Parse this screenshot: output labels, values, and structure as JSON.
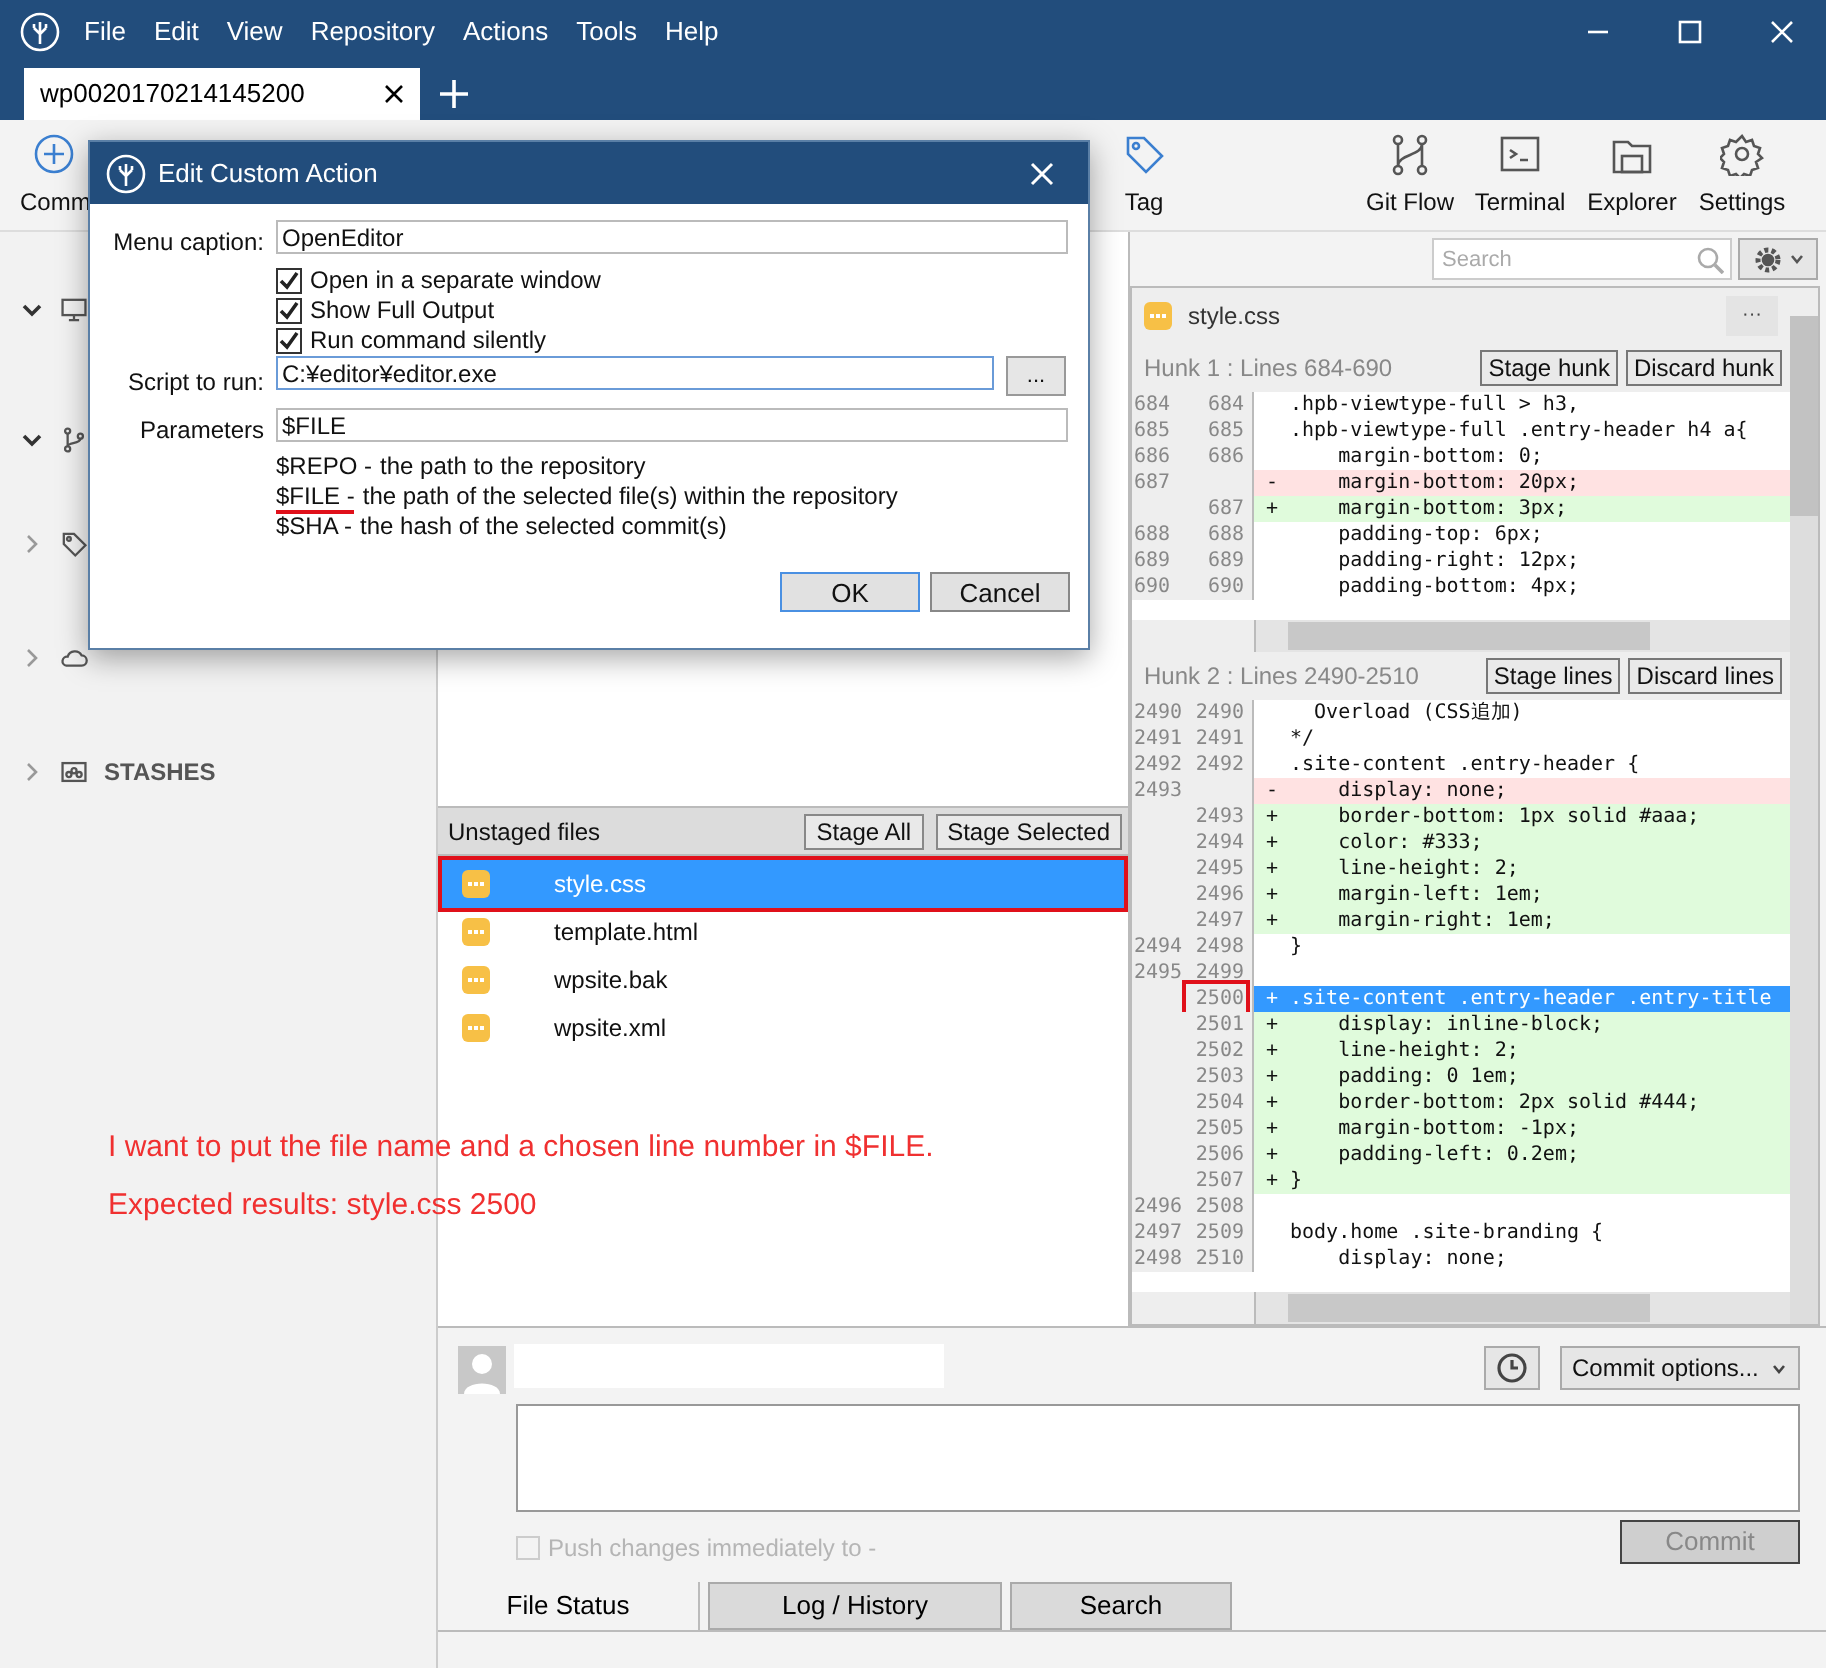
{
  "menu": [
    "File",
    "Edit",
    "View",
    "Repository",
    "Actions",
    "Tools",
    "Help"
  ],
  "tabs": [
    {
      "label": "wp0020170214145200",
      "selected": true
    }
  ],
  "toolbar": [
    {
      "label": "Comm",
      "kind": "commit"
    },
    {
      "label": "Tag",
      "kind": "tag"
    },
    {
      "label": "Git Flow",
      "kind": "gitflow"
    },
    {
      "label": "Terminal",
      "kind": "terminal"
    },
    {
      "label": "Explorer",
      "kind": "explorer"
    },
    {
      "label": "Settings",
      "kind": "settings"
    }
  ],
  "search": {
    "placeholder": "Search"
  },
  "sidebar": [
    {
      "kind": "workspace",
      "expanded": true
    },
    {
      "kind": "branches",
      "expanded": true
    },
    {
      "kind": "tags",
      "expanded": false
    },
    {
      "kind": "remotes",
      "expanded": false
    },
    {
      "kind": "stashes",
      "label": "STASHES",
      "expanded": false
    }
  ],
  "unstaged": {
    "title": "Unstaged files",
    "buttons": [
      "Stage All",
      "Stage Selected"
    ],
    "files": [
      {
        "name": "style.css",
        "selected": true,
        "highlighted": true
      },
      {
        "name": "template.html",
        "selected": false,
        "highlighted": false
      },
      {
        "name": "wpsite.bak",
        "selected": false,
        "highlighted": false
      },
      {
        "name": "wpsite.xml",
        "selected": false,
        "highlighted": false
      }
    ]
  },
  "diff": {
    "file": "style.css",
    "more": "···",
    "hunks": [
      {
        "title": "Hunk 1 : Lines 684-690",
        "buttons": [
          "Stage hunk",
          "Discard hunk"
        ],
        "lines": [
          {
            "old": "684",
            "new": "684",
            "kind": "context",
            "text": ".hpb-viewtype-full > h3,"
          },
          {
            "old": "685",
            "new": "685",
            "kind": "context",
            "text": ".hpb-viewtype-full .entry-header h4 a{"
          },
          {
            "old": "686",
            "new": "686",
            "kind": "context",
            "text": "    margin-bottom: 0;"
          },
          {
            "old": "687",
            "kind": "removed",
            "sign": "-",
            "text": "    margin-bottom: 20px;"
          },
          {
            "new": "687",
            "kind": "added",
            "sign": "+",
            "text": "    margin-bottom: 3px;"
          },
          {
            "old": "688",
            "new": "688",
            "kind": "context",
            "text": "    padding-top: 6px;"
          },
          {
            "old": "689",
            "new": "689",
            "kind": "context",
            "text": "    padding-right: 12px;"
          },
          {
            "old": "690",
            "new": "690",
            "kind": "context",
            "text": "    padding-bottom: 4px;"
          }
        ]
      },
      {
        "title": "Hunk 2 : Lines 2490-2510",
        "buttons": [
          "Stage lines",
          "Discard lines"
        ],
        "lines": [
          {
            "old": "2490",
            "new": "2490",
            "kind": "context",
            "text": "  Overload (CSS追加)"
          },
          {
            "old": "2491",
            "new": "2491",
            "kind": "context",
            "text": "*/"
          },
          {
            "old": "2492",
            "new": "2492",
            "kind": "context",
            "text": ".site-content .entry-header {"
          },
          {
            "old": "2493",
            "kind": "removed",
            "sign": "-",
            "text": "    display: none;"
          },
          {
            "new": "2493",
            "kind": "added",
            "sign": "+",
            "text": "    border-bottom: 1px solid #aaa;"
          },
          {
            "new": "2494",
            "kind": "added",
            "sign": "+",
            "text": "    color: #333;"
          },
          {
            "new": "2495",
            "kind": "added",
            "sign": "+",
            "text": "    line-height: 2;"
          },
          {
            "new": "2496",
            "kind": "added",
            "sign": "+",
            "text": "    margin-left: 1em;"
          },
          {
            "new": "2497",
            "kind": "added",
            "sign": "+",
            "text": "    margin-right: 1em;"
          },
          {
            "old": "2494",
            "new": "2498",
            "kind": "context",
            "text": "}"
          },
          {
            "old": "2495",
            "new": "2499",
            "kind": "context"
          },
          {
            "new": "2500",
            "kind": "added",
            "sign": "+",
            "text": ".site-content .entry-header .entry-title",
            "selected": true,
            "highlighted": true
          },
          {
            "new": "2501",
            "kind": "added",
            "sign": "+",
            "text": "    display: inline-block;"
          },
          {
            "new": "2502",
            "kind": "added",
            "sign": "+",
            "text": "    line-height: 2;"
          },
          {
            "new": "2503",
            "kind": "added",
            "sign": "+",
            "text": "    padding: 0 1em;"
          },
          {
            "new": "2504",
            "kind": "added",
            "sign": "+",
            "text": "    border-bottom: 2px solid #444;"
          },
          {
            "new": "2505",
            "kind": "added",
            "sign": "+",
            "text": "    margin-bottom: -1px;"
          },
          {
            "new": "2506",
            "kind": "added",
            "sign": "+",
            "text": "    padding-left: 0.2em;"
          },
          {
            "new": "2507",
            "kind": "added",
            "sign": "+",
            "text": "}"
          },
          {
            "old": "2496",
            "new": "2508",
            "kind": "context"
          },
          {
            "old": "2497",
            "new": "2509",
            "kind": "context",
            "text": "body.home .site-branding {"
          },
          {
            "old": "2498",
            "new": "2510",
            "kind": "context",
            "text": "    display: none;"
          }
        ]
      }
    ]
  },
  "annotations": [
    "I want to put the file name and a chosen line number in $FILE.",
    "Expected results: style.css 2500"
  ],
  "commit": {
    "options": "Commit options...",
    "push": {
      "label": "Push changes immediately to -",
      "checked": false,
      "disabled": true
    },
    "button": "Commit",
    "disabled": true
  },
  "bottom_tabs": [
    {
      "label": "File Status",
      "selected": true
    },
    {
      "label": "Log / History",
      "selected": false
    },
    {
      "label": "Search",
      "selected": false
    }
  ],
  "dialog": {
    "title": "Edit Custom Action",
    "caption_label": "Menu caption:",
    "caption": "OpenEditor",
    "checkboxes": [
      {
        "label": "Open in a separate window",
        "checked": true
      },
      {
        "label": "Show Full Output",
        "checked": true
      },
      {
        "label": "Run command silently",
        "checked": true
      }
    ],
    "script_label": "Script to run:",
    "script": "C:¥editor¥editor.exe",
    "browse": "...",
    "params_label": "Parameters",
    "params": "$FILE",
    "help": [
      {
        "term": "$REPO -",
        "desc": "the path to the repository",
        "underlined": false
      },
      {
        "term": "$FILE -",
        "desc": "the path of the selected file(s) within the repository",
        "underlined": true
      },
      {
        "term": "$SHA -",
        "desc": "the hash of the selected commit(s)",
        "underlined": false
      }
    ],
    "buttons": [
      {
        "label": "OK",
        "default": true
      },
      {
        "label": "Cancel",
        "default": false
      }
    ]
  }
}
